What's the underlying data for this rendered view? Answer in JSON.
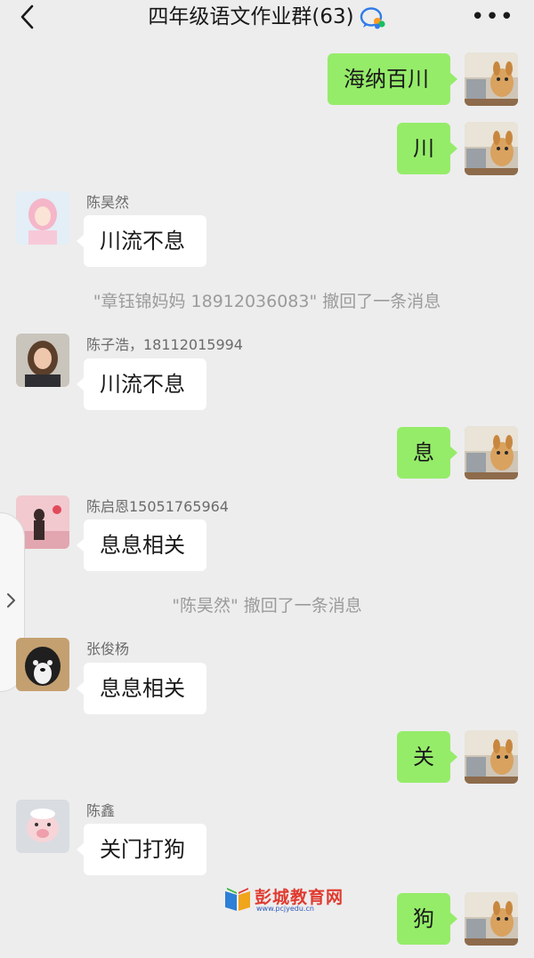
{
  "header": {
    "title": "四年级语文作业群(63)",
    "more": "•••"
  },
  "messages": [
    {
      "from": "me",
      "text": "海纳百川"
    },
    {
      "from": "me",
      "text": "川"
    },
    {
      "from": "other",
      "name": "陈昊然",
      "text": "川流不息"
    },
    {
      "system": "\"章钰锦妈妈 18912036083\" 撤回了一条消息"
    },
    {
      "from": "other",
      "name": "陈子浩，18112015994",
      "text": "川流不息"
    },
    {
      "from": "me",
      "text": "息"
    },
    {
      "from": "other",
      "name": "陈启恩15051765964",
      "text": "息息相关"
    },
    {
      "system": "\"陈昊然\" 撤回了一条消息"
    },
    {
      "from": "other",
      "name": "张俊杨",
      "text": "息息相关"
    },
    {
      "from": "me",
      "text": "关"
    },
    {
      "from": "other",
      "name": "陈鑫",
      "text": "关门打狗"
    },
    {
      "from": "me",
      "text": "狗"
    }
  ],
  "watermark": {
    "title": "彭城教育网",
    "url": "www.pcjyedu.cn"
  },
  "colors": {
    "background": "#ededed",
    "my_bubble": "#95ec69",
    "other_bubble": "#ffffff",
    "system_text": "#9b9b9b",
    "name_text": "#6b6b6b"
  },
  "icons": [
    "back-arrow-icon",
    "group-chat-icon",
    "more-icon",
    "expand-chevron-icon"
  ]
}
